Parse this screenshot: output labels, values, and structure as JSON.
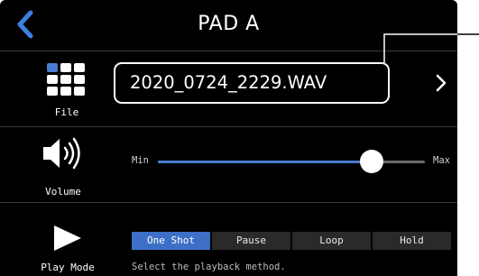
{
  "header": {
    "title": "PAD A"
  },
  "file": {
    "label": "File",
    "filename": "2020_0724_2229.WAV"
  },
  "volume": {
    "label": "Volume",
    "min_label": "Min",
    "max_label": "Max",
    "level_fraction": 0.8
  },
  "play_mode": {
    "label": "Play Mode",
    "options": [
      "One Shot",
      "Pause",
      "Loop",
      "Hold"
    ],
    "selected": "One Shot",
    "hint": "Select the playback method."
  },
  "colors": {
    "accent": "#3d6fc6",
    "slider_fill": "#4a7bd0",
    "background": "#000000"
  },
  "icons": {
    "back": "chevron-left-icon",
    "file": "grid-icon",
    "next": "chevron-right-icon",
    "volume": "speaker-icon",
    "play_mode": "play-icon"
  }
}
